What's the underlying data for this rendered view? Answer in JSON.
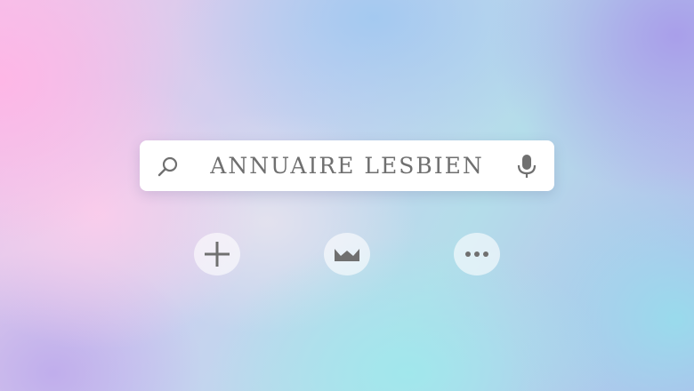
{
  "search": {
    "query": "ANNUAIRE LESBIEN",
    "search_icon": "search-icon",
    "mic_icon": "microphone-icon"
  },
  "actions": [
    {
      "icon": "plus-icon"
    },
    {
      "icon": "crown-icon"
    },
    {
      "icon": "more-dots-icon"
    }
  ],
  "colors": {
    "text": "#6f6f6f",
    "icon": "#707070",
    "search_bg": "#ffffff"
  }
}
